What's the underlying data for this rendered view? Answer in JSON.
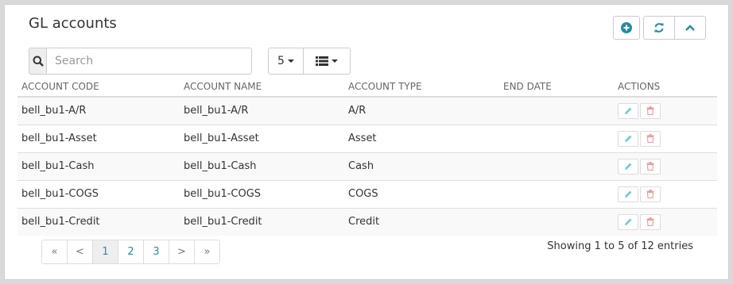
{
  "panel": {
    "title": "GL accounts",
    "header_buttons": {
      "add_icon": "plus-circle-icon",
      "refresh_icon": "refresh-icon",
      "collapse_icon": "chevron-up-icon"
    }
  },
  "search": {
    "placeholder": "Search",
    "value": "",
    "icon": "search-icon"
  },
  "toolbar": {
    "page_size": "5",
    "columns_icon": "list-icon"
  },
  "table": {
    "columns": [
      "ACCOUNT CODE",
      "ACCOUNT NAME",
      "ACCOUNT TYPE",
      "END DATE",
      "ACTIONS"
    ],
    "rows": [
      {
        "code": "bell_bu1-A/R",
        "name": "bell_bu1-A/R",
        "type": "A/R",
        "end_date": ""
      },
      {
        "code": "bell_bu1-Asset",
        "name": "bell_bu1-Asset",
        "type": "Asset",
        "end_date": ""
      },
      {
        "code": "bell_bu1-Cash",
        "name": "bell_bu1-Cash",
        "type": "Cash",
        "end_date": ""
      },
      {
        "code": "bell_bu1-COGS",
        "name": "bell_bu1-COGS",
        "type": "COGS",
        "end_date": ""
      },
      {
        "code": "bell_bu1-Credit",
        "name": "bell_bu1-Credit",
        "type": "Credit",
        "end_date": ""
      }
    ],
    "row_actions": {
      "edit_icon": "pencil-icon",
      "delete_icon": "trash-icon"
    }
  },
  "pagination": {
    "first": "«",
    "prev": "<",
    "pages": [
      "1",
      "2",
      "3"
    ],
    "active_page": "1",
    "next": ">",
    "last": "»"
  },
  "summary": "Showing 1 to 5 of 12 entries",
  "colors": {
    "accent": "#2a8a9e",
    "edit": "#7fc7d3",
    "delete": "#e6a0a0"
  }
}
